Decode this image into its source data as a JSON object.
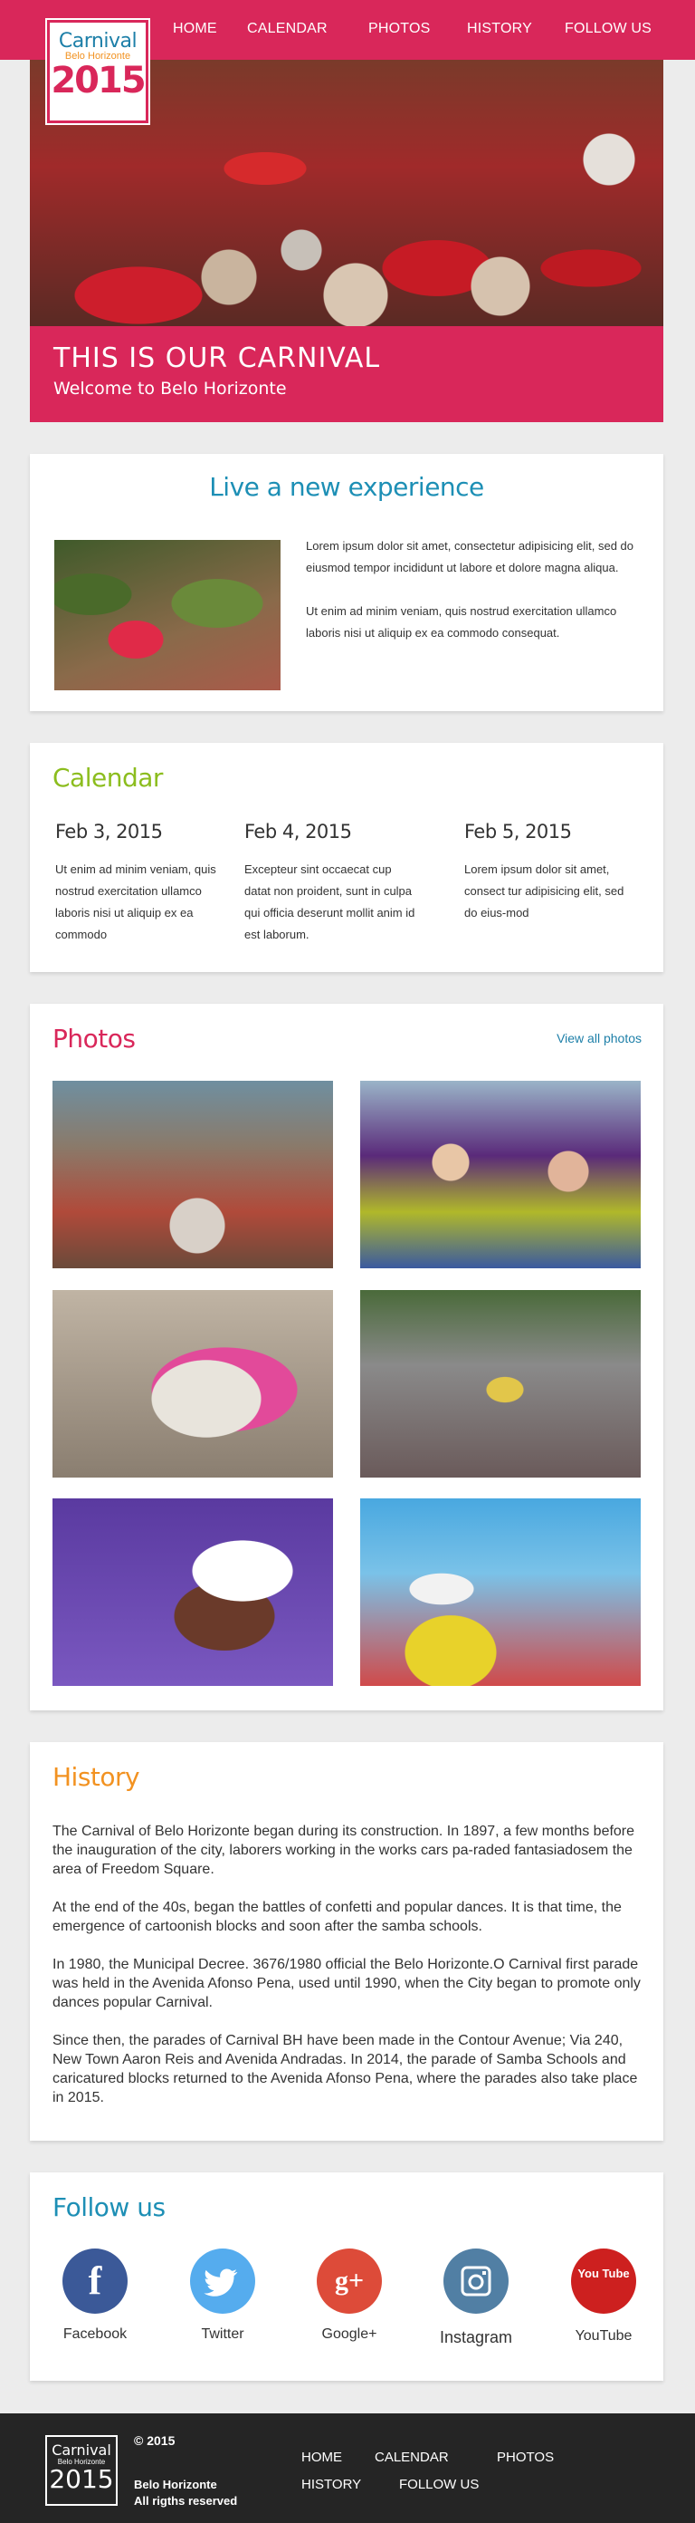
{
  "brand": {
    "line1": "Carnival",
    "line2a": "Belo",
    "line2b": "Horizonte",
    "year": "2015"
  },
  "nav": [
    "HOME",
    "CALENDAR",
    "PHOTOS",
    "HISTORY",
    "FOLLOW US"
  ],
  "hero": {
    "title": "THIS IS OUR CARNIVAL",
    "subtitle": "Welcome to Belo Horizonte"
  },
  "experience": {
    "title": "Live a new experience",
    "para1": "Lorem ipsum dolor sit amet, consectetur adipisicing elit, sed do eiusmod tempor incididunt ut labore et dolore magna aliqua.",
    "para2": "Ut enim ad minim veniam, quis nostrud exercitation ullamco laboris nisi ut aliquip ex ea commodo consequat."
  },
  "calendar": {
    "title": "Calendar",
    "events": [
      {
        "date": "Feb 3, 2015",
        "text": "Ut enim ad minim veniam, quis nostrud exercitation ullamco laboris nisi ut aliquip ex ea commodo"
      },
      {
        "date": "Feb 4, 2015",
        "text": "Excepteur sint occaecat cup datat non proident, sunt in culpa qui officia deserunt mollit anim id est laborum."
      },
      {
        "date": "Feb 5, 2015",
        "text": "Lorem ipsum dolor sit amet, consect tur adipisicing elit, sed do eius-mod"
      }
    ]
  },
  "photos": {
    "title": "Photos",
    "view_all": "View all photos"
  },
  "history": {
    "title": "History",
    "paragraphs": [
      "The Carnival of Belo Horizonte began during its construction. In 1897, a few months before the inauguration of the city, laborers working in the works cars pa-raded fantasiadosem the area of Freedom Square.",
      "At the end of the 40s, began the battles of confetti and popular dances. It is that time, the emergence of cartoonish blocks and soon after the samba schools.",
      "In 1980, the Municipal Decree. 3676/1980 official the Belo Horizonte.O Carnival first parade was held in the Avenida Afonso Pena, used until 1990, when the City began to promote only dances popular Carnival.",
      "Since then, the parades of Carnival BH have been made in the Contour Avenue; Via 240, New Town Aaron Reis and Avenida Andradas. In 2014, the parade of Samba Schools and caricatured blocks returned to the Avenida Afonso Pena, where the parades also take place in 2015."
    ]
  },
  "follow": {
    "title": "Follow us",
    "networks": [
      {
        "label": "Facebook",
        "glyph": "f",
        "color": "#3b5998",
        "icon": "facebook-icon"
      },
      {
        "label": "Twitter",
        "glyph": "t",
        "color": "#55acee",
        "icon": "twitter-icon"
      },
      {
        "label": "Google+",
        "glyph": "g+",
        "color": "#dd4b39",
        "icon": "google-plus-icon"
      },
      {
        "label": "Instagram",
        "glyph": "◙",
        "color": "#517fa4",
        "icon": "instagram-icon"
      },
      {
        "label": "YouTube",
        "glyph": "You Tube",
        "color": "#cd201f",
        "icon": "youtube-icon"
      }
    ]
  },
  "footer": {
    "copyright": "© 2015",
    "city": "Belo Horizonte",
    "rights": "All rigths reserved",
    "nav": [
      "HOME",
      "CALENDAR",
      "PHOTOS",
      "HISTORY",
      "FOLLOW US"
    ],
    "logo_line1": "Carnival",
    "logo_line2": "Belo Horizonte",
    "logo_year": "2015"
  }
}
